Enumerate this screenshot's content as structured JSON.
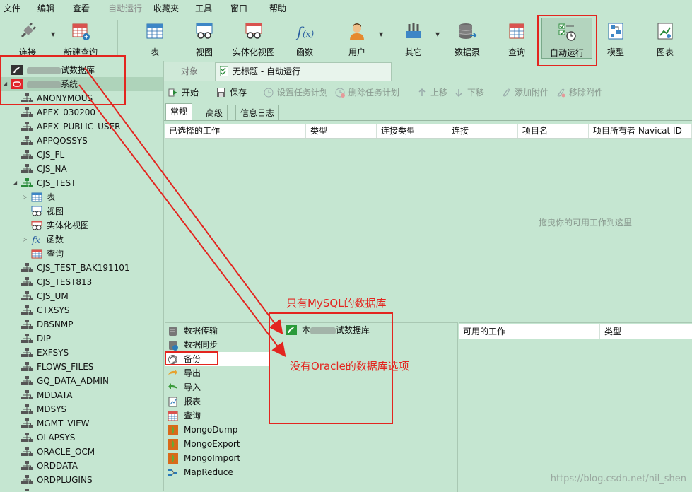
{
  "menu": [
    "文件",
    "编辑",
    "查看",
    "自动运行",
    "收藏夹",
    "工具",
    "窗口",
    "帮助"
  ],
  "toolbar": {
    "connect": "连接",
    "new_query": "新建查询",
    "table": "表",
    "view": "视图",
    "mview": "实体化视图",
    "function": "函数",
    "user": "用户",
    "other": "其它",
    "datapump": "数据泵",
    "query": "查询",
    "automation": "自动运行",
    "model": "模型",
    "chart": "图表"
  },
  "tree": {
    "conn_mysql_suffix": "试数据库",
    "conn_oracle_suffix": "系统",
    "schemas_a": [
      "ANONYMOUS",
      "APEX_030200",
      "APEX_PUBLIC_USER",
      "APPQOSSYS",
      "CJS_FL",
      "CJS_NA"
    ],
    "cjs_test": "CJS_TEST",
    "cjs_children": [
      "表",
      "视图",
      "实体化视图",
      "函数",
      "查询"
    ],
    "schemas_b": [
      "CJS_TEST_BAK191101",
      "CJS_TEST813",
      "CJS_UM",
      "CTXSYS",
      "DBSNMP",
      "DIP",
      "EXFSYS",
      "FLOWS_FILES",
      "GQ_DATA_ADMIN",
      "MDDATA",
      "MDSYS",
      "MGMT_VIEW",
      "OLAPSYS",
      "ORACLE_OCM",
      "ORDDATA",
      "ORDPLUGINS",
      "ORDSYS"
    ]
  },
  "tabs": {
    "objects": "对象",
    "current": "无标题 - 自动运行"
  },
  "actions": {
    "start": "开始",
    "save": "保存",
    "set_schedule": "设置任务计划",
    "delete_schedule": "删除任务计划",
    "move_up": "上移",
    "move_down": "下移",
    "add_attachment": "添加附件",
    "remove_attachment": "移除附件"
  },
  "subtabs": [
    "常规",
    "高级",
    "信息日志"
  ],
  "grid_columns": [
    "已选择的工作",
    "类型",
    "连接类型",
    "连接",
    "项目名",
    "项目所有者 Navicat ID"
  ],
  "drop_hint": "拖曳你的可用工作到这里",
  "job_types": [
    "数据传输",
    "数据同步",
    "备份",
    "导出",
    "导入",
    "报表",
    "查询",
    "MongoDump",
    "MongoExport",
    "MongoImport",
    "MapReduce"
  ],
  "mid_panel": {
    "conn_prefix": "本",
    "conn_suffix": "试数据库"
  },
  "available": {
    "col_jobs": "可用的工作",
    "col_type": "类型"
  },
  "annotations": {
    "mysql_only": "只有MySQL的数据库",
    "no_oracle": "没有Oracle的数据库选项"
  },
  "watermark": "https://blog.csdn.net/nil_shen",
  "colors": {
    "background": "#c5e6d1",
    "highlight_box": "#e3251f"
  }
}
